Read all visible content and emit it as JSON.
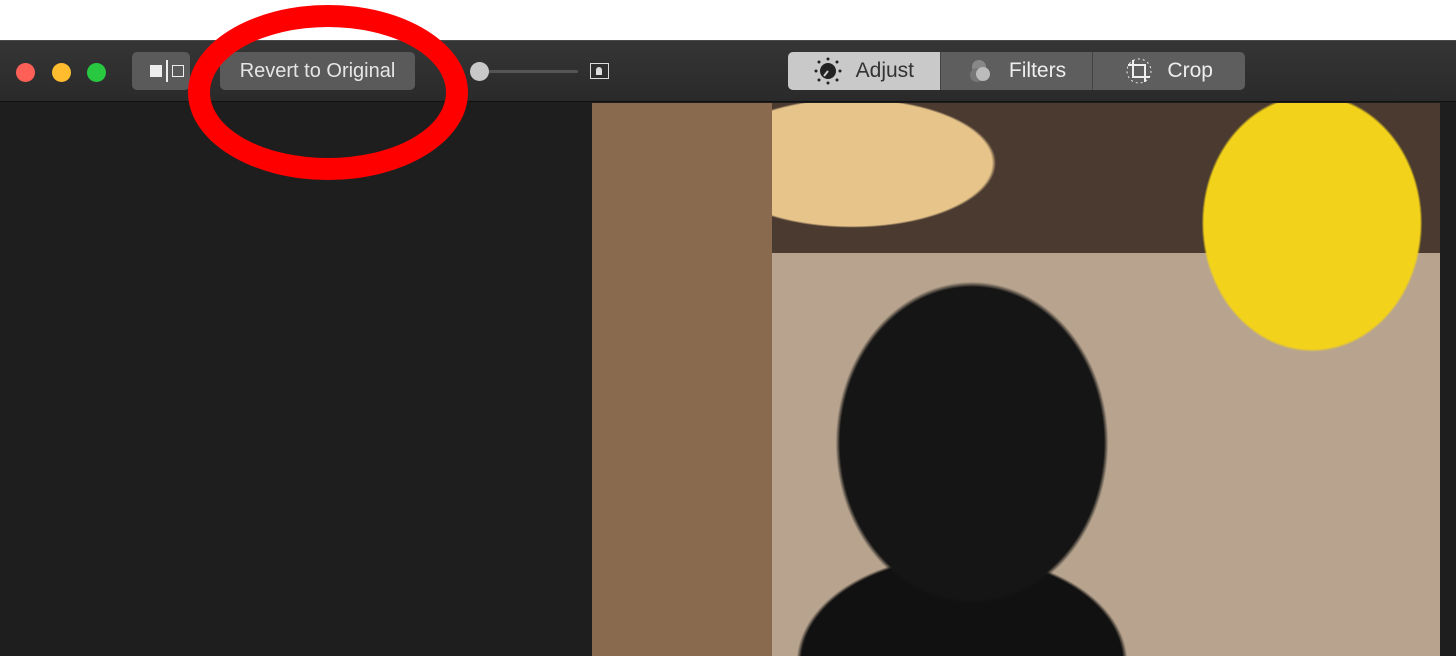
{
  "toolbar": {
    "revert_label": "Revert to Original",
    "tabs": [
      {
        "label": "Adjust",
        "icon": "adjust-dial-icon",
        "active": true
      },
      {
        "label": "Filters",
        "icon": "filters-circles-icon",
        "active": false
      },
      {
        "label": "Crop",
        "icon": "crop-icon",
        "active": false
      }
    ]
  },
  "window_controls": {
    "close": "#fe5f57",
    "minimize": "#febc2e",
    "zoom": "#28c840"
  },
  "annotation_color": "#ff0000"
}
